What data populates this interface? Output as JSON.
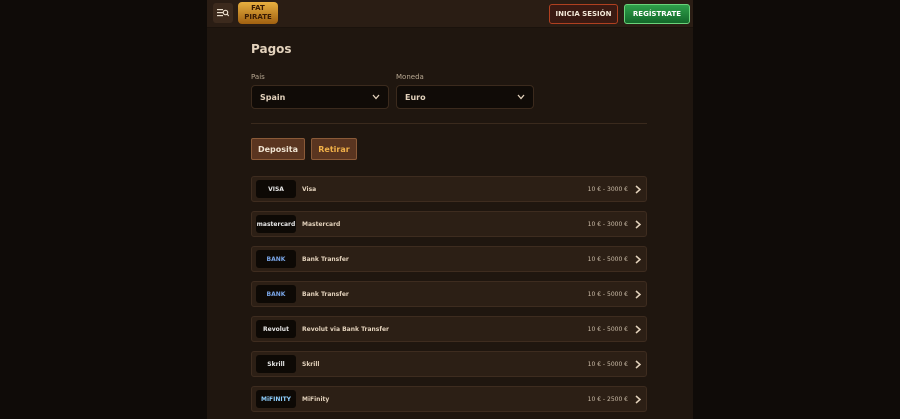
{
  "header": {
    "logo_line1": "FAT",
    "logo_line2": "PIRATE",
    "login_label": "INICIA SESIÓN",
    "register_label": "REGÍSTRATE"
  },
  "page": {
    "title": "Pagos",
    "country_label": "País",
    "country_value": "Spain",
    "currency_label": "Moneda",
    "currency_value": "Euro",
    "tabs": [
      {
        "label": "Deposita"
      },
      {
        "label": "Retirar"
      }
    ]
  },
  "payments": [
    {
      "logo_text": "VISA",
      "name": "Visa",
      "range": "10 € - 3000 €"
    },
    {
      "logo_text": "mastercard",
      "name": "Mastercard",
      "range": "10 € - 3000 €"
    },
    {
      "logo_text": "BANK",
      "name": "Bank Transfer",
      "range": "10 € - 5000 €"
    },
    {
      "logo_text": "BANK",
      "name": "Bank Transfer",
      "range": "10 € - 5000 €"
    },
    {
      "logo_text": "Revolut",
      "name": "Revolut via Bank Transfer",
      "range": "10 € - 5000 €"
    },
    {
      "logo_text": "Skrill",
      "name": "Skrill",
      "range": "10 € - 5000 €"
    },
    {
      "logo_text": "MiFINITY",
      "name": "MiFinity",
      "range": "10 € - 2500 €"
    }
  ],
  "colors": {
    "accent_green": "#2fa04a",
    "accent_red": "#b04020",
    "tab_active_text": "#f0b048"
  }
}
